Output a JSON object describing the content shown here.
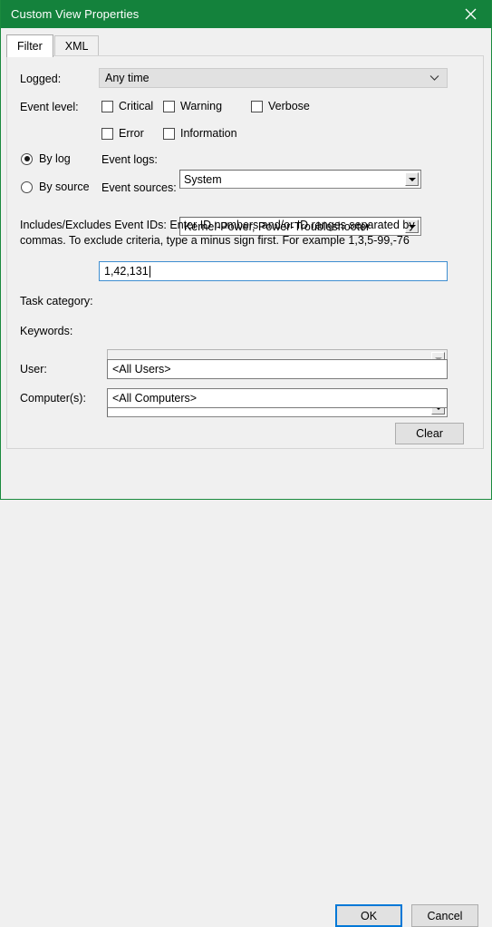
{
  "window": {
    "title": "Custom View Properties",
    "close_icon": "close-icon",
    "accent_color": "#14823c"
  },
  "tabs": [
    {
      "label": "Filter",
      "active": true
    },
    {
      "label": "XML",
      "active": false
    }
  ],
  "filter": {
    "logged": {
      "label": "Logged:",
      "value": "Any time",
      "icon": "chevron-down-icon"
    },
    "event_level": {
      "label": "Event level:",
      "options": [
        {
          "label": "Critical",
          "checked": false
        },
        {
          "label": "Warning",
          "checked": false
        },
        {
          "label": "Verbose",
          "checked": false
        },
        {
          "label": "Error",
          "checked": false
        },
        {
          "label": "Information",
          "checked": false
        }
      ]
    },
    "source_mode": {
      "by_log": {
        "label": "By log",
        "selected": true
      },
      "by_source": {
        "label": "By source",
        "selected": false
      }
    },
    "event_logs": {
      "label": "Event logs:",
      "value": "System",
      "enabled": true
    },
    "event_sources": {
      "label": "Event sources:",
      "value": "Kernel-Power, Power-Troubleshooter",
      "enabled": true
    },
    "event_ids": {
      "hint": "Includes/Excludes Event IDs: Enter ID numbers and/or ID ranges separated by commas. To exclude criteria, type a minus sign first. For example 1,3,5-99,-76",
      "value": "1,42,131",
      "focused": true
    },
    "task_category": {
      "label": "Task category:",
      "value": "",
      "enabled": false
    },
    "keywords": {
      "label": "Keywords:",
      "value": "",
      "enabled": true
    },
    "user": {
      "label": "User:",
      "value": "<All Users>"
    },
    "computers": {
      "label": "Computer(s):",
      "value": "<All Computers>"
    },
    "clear_button": "Clear"
  },
  "footer": {
    "ok_label": "OK",
    "cancel_label": "Cancel",
    "default_button_color": "#0078d7"
  }
}
